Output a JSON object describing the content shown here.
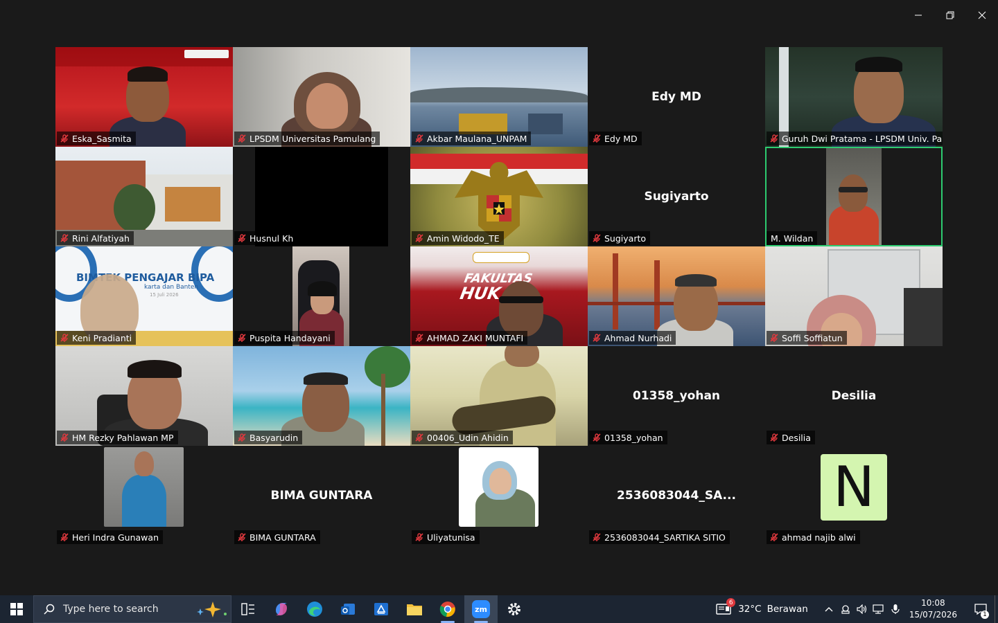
{
  "window": {
    "minimize": "minimize",
    "restore": "restore",
    "close": "close"
  },
  "participants": [
    {
      "name": "Eska_Sasmita",
      "muted": true
    },
    {
      "name": "LPSDM Universitas Pamulang",
      "muted": true
    },
    {
      "name": "Akbar Maulana_UNPAM",
      "muted": true
    },
    {
      "name": "Edy MD",
      "muted": true,
      "center": "Edy MD"
    },
    {
      "name": "Guruh Dwi Pratama - LPSDM Univ. Pa...",
      "muted": true
    },
    {
      "name": "Rini Alfatiyah",
      "muted": true
    },
    {
      "name": "Husnul Kh",
      "muted": true
    },
    {
      "name": "Amin Widodo_TE",
      "muted": true
    },
    {
      "name": "Sugiyarto",
      "muted": true,
      "center": "Sugiyarto"
    },
    {
      "name": "M. Wildan",
      "muted": false,
      "active": true
    },
    {
      "name": "Keni Pradianti",
      "muted": true
    },
    {
      "name": "Puspita Handayani",
      "muted": true
    },
    {
      "name": "AHMAD ZAKI MUNTAFI",
      "muted": true
    },
    {
      "name": "Ahmad Nurhadi",
      "muted": true
    },
    {
      "name": "Soffi Soffiatun",
      "muted": true
    },
    {
      "name": "HM Rezky Pahlawan MP",
      "muted": true
    },
    {
      "name": "Basyarudin",
      "muted": true
    },
    {
      "name": "00406_Udin Ahidin",
      "muted": true
    },
    {
      "name": "01358_yohan",
      "muted": true,
      "center": "01358_yohan"
    },
    {
      "name": "Desilia",
      "muted": true,
      "center": "Desilia"
    },
    {
      "name": "Heri Indra Gunawan",
      "muted": true
    },
    {
      "name": "BIMA GUNTARA",
      "muted": true,
      "center": "BIMA GUNTARA"
    },
    {
      "name": "Uliyatunisa",
      "muted": true
    },
    {
      "name": "2536083044_SARTIKA SITIO",
      "muted": true,
      "center": "2536083044_SA..."
    },
    {
      "name": "ahmad najib alwi",
      "muted": true
    }
  ],
  "slides": {
    "bipa_title": "BIMTEK PENGAJAR BIPA",
    "bipa_sub": "karta dan Banten",
    "bipa_date": "15 Juli 2026",
    "fakultas": "FAKULTAS",
    "hukum": "HUK",
    "avatar_letter": "N"
  },
  "taskbar": {
    "search_placeholder": "Type here to search",
    "weather_badge": "6",
    "temperature": "32°C",
    "weather_text": "Berawan",
    "time": "10:08",
    "date": "15/07/2026",
    "notification_count": "1",
    "zoom_label": "zm"
  },
  "colors": {
    "active_border": "#2dcc70",
    "mute_red": "#e0393e",
    "taskbar_bg": "#1c2532"
  }
}
